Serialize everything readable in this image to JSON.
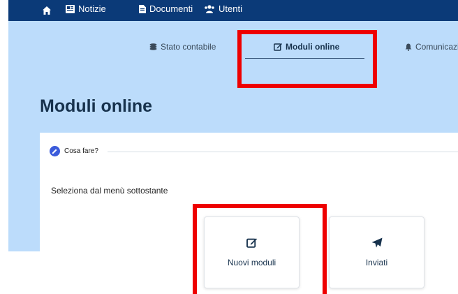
{
  "topnav": {
    "items": [
      {
        "label": "Notizie",
        "icon": "newspaper-icon"
      },
      {
        "label": "Documenti",
        "icon": "file-icon"
      },
      {
        "label": "Utenti",
        "icon": "users-icon"
      }
    ],
    "home_icon": "home-icon"
  },
  "tabs": [
    {
      "label": "Stato contabile",
      "icon": "coins-icon"
    },
    {
      "label": "Moduli online",
      "icon": "edit-icon",
      "active": true
    },
    {
      "label": "Comunicazion",
      "icon": "bell-icon"
    }
  ],
  "page": {
    "title": "Moduli online"
  },
  "callout": {
    "title": "Cosa fare?",
    "icon": "pencil-icon"
  },
  "instructions": "Seleziona dal menù sottostante",
  "tiles": [
    {
      "label": "Nuovi moduli",
      "icon": "edit-icon"
    },
    {
      "label": "Inviati",
      "icon": "send-icon"
    }
  ],
  "colors": {
    "topbar": "#0b3a78",
    "hero": "#bcdcfb",
    "title": "#17324d",
    "highlight": "#ee0000",
    "callout_icon": "#3b5bdb"
  }
}
